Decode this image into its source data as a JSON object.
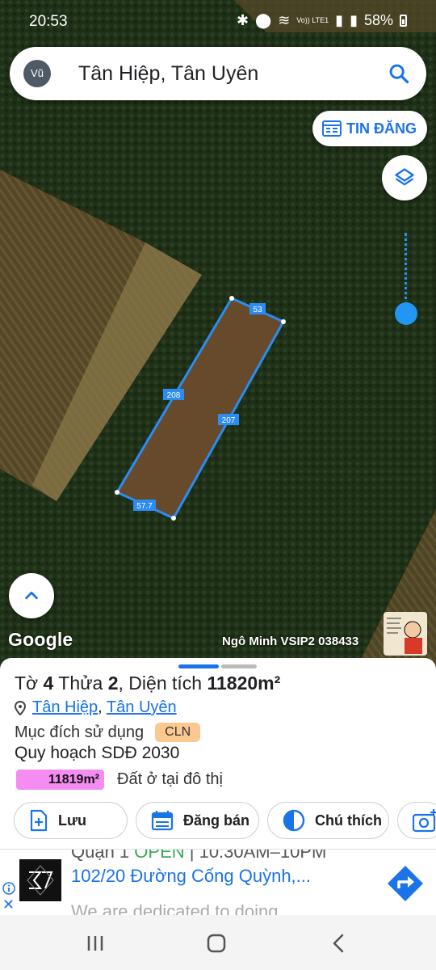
{
  "status_bar": {
    "time": "20:53",
    "network_label": "Vo)) LTE1",
    "battery": "58%"
  },
  "search": {
    "avatar_label": "Vũ",
    "query": "Tân Hiệp, Tân Uyên"
  },
  "map": {
    "tin_dang_label": "TIN ĐĂNG",
    "edge_labels": {
      "top": "53",
      "left": "208",
      "right": "207",
      "bottom": "57.7"
    },
    "google_logo": "Google",
    "watermark": "Ngô Minh VSIP2 038433"
  },
  "parcel": {
    "sheet_prefix": "Tờ ",
    "sheet_no": "4",
    "plot_prefix": " Thửa ",
    "plot_no": "2",
    "area_prefix": ", Diện tích ",
    "area": "11820m²",
    "ward": "Tân Hiệp",
    "separator": ",",
    "district": "Tân Uyên",
    "purpose_label": "Mục đích sử dụng",
    "purpose_code": "CLN",
    "plan_title": "Quy hoạch SDĐ 2030",
    "plan_area": "11819m²",
    "plan_desc": "Đất ở tại đô thị",
    "plan_color": "#f58cf2"
  },
  "actions": {
    "save": "Lưu",
    "post": "Đăng bán",
    "legend": "Chú thích"
  },
  "ad": {
    "line1_a": "Quận 1 ",
    "line1_open": "OPEN",
    "line1_b": " | 10:30AM–10PM",
    "line2": "102/20 Đường Cống Quỳnh,...",
    "line3": "We are dedicated to doing"
  },
  "colors": {
    "accent": "#1a73e8",
    "boundary": "#2b8cf2",
    "badge": "#fbc88f"
  }
}
